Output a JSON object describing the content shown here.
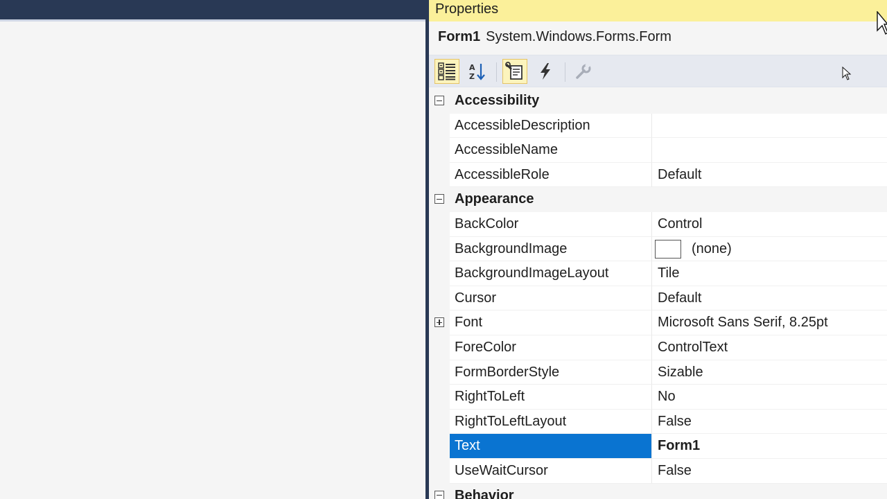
{
  "panel": {
    "title": "Properties",
    "object_name": "Form1",
    "object_type": "System.Windows.Forms.Form"
  },
  "toolbar": {
    "buttons": [
      {
        "icon": "categorized-icon",
        "active": true
      },
      {
        "icon": "alphabetical-icon",
        "active": false
      },
      {
        "icon": "properties-icon",
        "active": true
      },
      {
        "icon": "events-icon",
        "active": false
      },
      {
        "icon": "property-pages-icon",
        "active": false
      }
    ]
  },
  "grid": {
    "categories": [
      {
        "label": "Accessibility",
        "properties": [
          {
            "name": "AccessibleDescription",
            "value": ""
          },
          {
            "name": "AccessibleName",
            "value": ""
          },
          {
            "name": "AccessibleRole",
            "value": "Default"
          }
        ]
      },
      {
        "label": "Appearance",
        "properties": [
          {
            "name": "BackColor",
            "value": "Control"
          },
          {
            "name": "BackgroundImage",
            "value": "(none)"
          },
          {
            "name": "BackgroundImageLayout",
            "value": "Tile"
          },
          {
            "name": "Cursor",
            "value": "Default"
          },
          {
            "name": "Font",
            "value": "Microsoft Sans Serif, 8.25pt"
          },
          {
            "name": "ForeColor",
            "value": "ControlText"
          },
          {
            "name": "FormBorderStyle",
            "value": "Sizable"
          },
          {
            "name": "RightToLeft",
            "value": "No"
          },
          {
            "name": "RightToLeftLayout",
            "value": "False"
          },
          {
            "name": "Text",
            "value": "Form1"
          },
          {
            "name": "UseWaitCursor",
            "value": "False"
          }
        ]
      },
      {
        "label": "Behavior",
        "properties": []
      }
    ]
  },
  "colors": {
    "title_bar": "#fbf09a",
    "selection": "#0a74d1",
    "dark_chrome": "#293955"
  }
}
